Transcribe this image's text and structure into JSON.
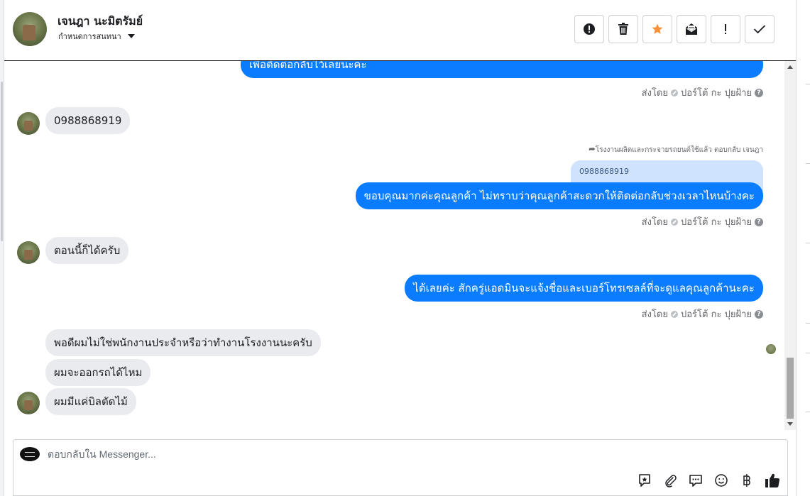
{
  "header": {
    "contact_name": "เจนฎา นะมิตรัมย์",
    "assign_label": "กำหนดการสนทนา",
    "buttons": [
      {
        "name": "spam-icon"
      },
      {
        "name": "trash-icon"
      },
      {
        "name": "star-icon"
      },
      {
        "name": "mark-unread-icon"
      },
      {
        "name": "exclamation-icon"
      },
      {
        "name": "check-icon"
      }
    ],
    "star_color": "#f7923a"
  },
  "messages": {
    "out_1": "เพื่อติดต่อกลับไว้เลยนะคะ",
    "sent_by_1": "ส่งโดย",
    "sender_1": "ปอร์โต้ กะ ปุยฝ้าย",
    "in_1": "0988868919",
    "reply_note": "โรงงานผลิตและกระจายรถยนต์ใช้แล้ว ตอบกลับ เจนฎา",
    "quoted_text": "0988868919",
    "out_2": "ขอบคุณมากค่ะคุณลูกค้า ไม่ทราบว่าคุณลูกค้าสะดวกให้ติดต่อกลับช่วงเวลาไหนบ้างคะ",
    "sent_by_2": "ส่งโดย",
    "sender_2": "ปอร์โต้ กะ ปุยฝ้าย",
    "in_2": "ตอนนี้ก็ได้ครับ",
    "out_3": "ได้เลยค่ะ สักครู่แอดมินจะแจ้งชื่อและเบอร์โทรเซลล์ที่จะดูแลคุณลูกค้านะคะ",
    "sent_by_3": "ส่งโดย",
    "sender_3": "ปอร์โต้ กะ ปุยฝ้าย",
    "in_3": "พอดีผมไม่ใช่พนักงานประจำหรือว่าทำงานโรงงานนะครับ",
    "in_4": "ผมจะออกรถได้ไหม",
    "in_5": "ผมมีแค่บิลตัดไม้"
  },
  "colors": {
    "outgoing": "#0a7cff",
    "incoming": "#e9ebee"
  },
  "composer": {
    "placeholder": "ตอบกลับใน Messenger...",
    "tools": [
      "saved-reply-icon",
      "attach-icon",
      "chat-icon",
      "emoji-icon",
      "baht-icon",
      "like-icon"
    ]
  }
}
